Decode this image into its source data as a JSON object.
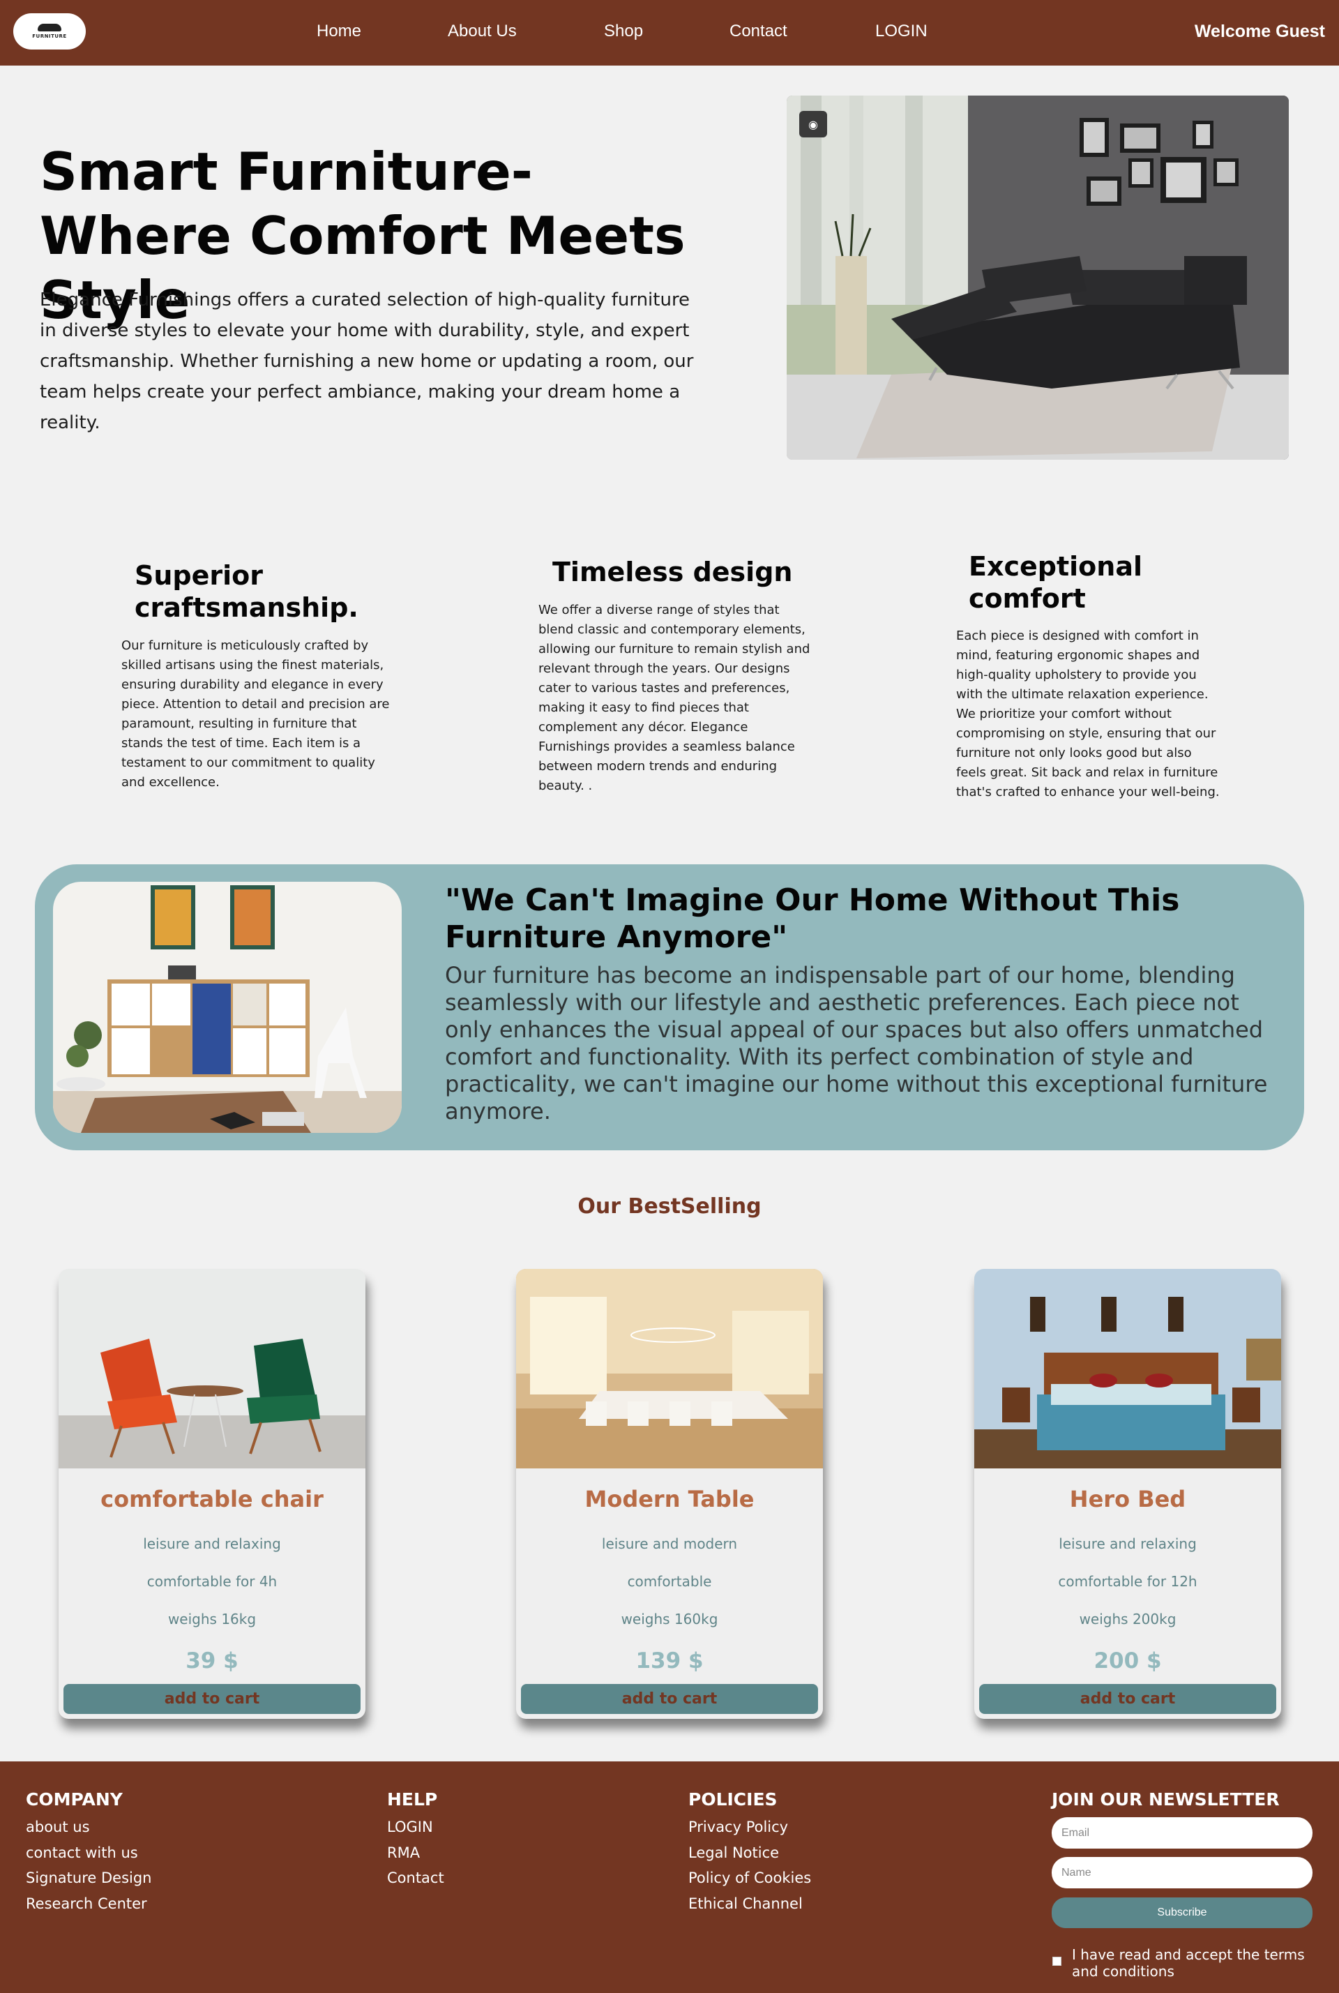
{
  "nav": {
    "logo_text": "FURNITURE",
    "links": [
      "Home",
      "About Us",
      "Shop",
      "Contact",
      "LOGIN"
    ],
    "welcome": "Welcome Guest"
  },
  "hero": {
    "title": "Smart Furniture- Where Comfort Meets Style",
    "text": "Elegance Furnishings offers a curated selection of high-quality furniture in diverse styles to elevate your home with durability, style, and expert craftsmanship. Whether furnishing a new home or updating a room, our team helps create your perfect ambiance, making your dream home a reality."
  },
  "features": [
    {
      "title": "Superior craftsmanship.",
      "text": "Our furniture is meticulously crafted by skilled artisans using the finest materials, ensuring durability and elegance in every piece. Attention to detail and precision are paramount, resulting in furniture that stands the test of time. Each item is a testament to our commitment to quality and excellence."
    },
    {
      "title": "Timeless design",
      "text": "We offer a diverse range of styles that blend classic and contemporary elements, allowing our furniture to remain stylish and relevant through the years. Our designs cater to various tastes and preferences, making it easy to find pieces that complement any décor. Elegance Furnishings provides a seamless balance between modern trends and enduring beauty. ."
    },
    {
      "title": "Exceptional comfort",
      "text": "Each piece is designed with comfort in mind, featuring ergonomic shapes and high-quality upholstery to provide you with the ultimate relaxation experience. We prioritize your comfort without compromising on style, ensuring that our furniture not only looks good but also feels great. Sit back and relax in furniture that's crafted to enhance your well-being."
    }
  ],
  "testimonial": {
    "title": "\"We Can't Imagine Our Home Without This Furniture Anymore\"",
    "text": "Our furniture has become an indispensable part of our home, blending seamlessly with our lifestyle and aesthetic preferences. Each piece not only enhances the visual appeal of our spaces but also offers unmatched comfort and functionality. With its perfect combination of style and practicality, we can't imagine our home without this exceptional furniture anymore."
  },
  "bestselling": {
    "title": "Our BestSelling",
    "cart_label": "add to cart",
    "products": [
      {
        "name": "comfortable chair",
        "f1": "leisure and relaxing",
        "f2": "comfortable for 4h",
        "f3": "weighs 16kg",
        "price": "39 $"
      },
      {
        "name": "Modern Table",
        "f1": "leisure and modern",
        "f2": "comfortable",
        "f3": "weighs 160kg",
        "price": "139 $"
      },
      {
        "name": "Hero Bed",
        "f1": "leisure and relaxing",
        "f2": "comfortable for 12h",
        "f3": "weighs 200kg",
        "price": "200 $"
      }
    ]
  },
  "footer": {
    "company": {
      "title": "COMPANY",
      "links": [
        "about us",
        "contact with us",
        "Signature Design",
        "Research Center"
      ]
    },
    "help": {
      "title": "HELP",
      "links": [
        "LOGIN",
        "RMA",
        "Contact"
      ]
    },
    "policies": {
      "title": "POLICIES",
      "links": [
        "Privacy Policy",
        "Legal Notice",
        "Policy of Cookies",
        "Ethical Channel"
      ]
    },
    "newsletter": {
      "title": "JOIN OUR NEWSLETTER",
      "email_placeholder": "Email",
      "name_placeholder": "Name",
      "subscribe": "Subscribe",
      "terms": "I have read and accept the terms and conditions"
    }
  },
  "colors": {
    "primary": "#733622",
    "teal": "#93b9bd",
    "button": "#5b878b",
    "product_name": "#b86b45"
  }
}
